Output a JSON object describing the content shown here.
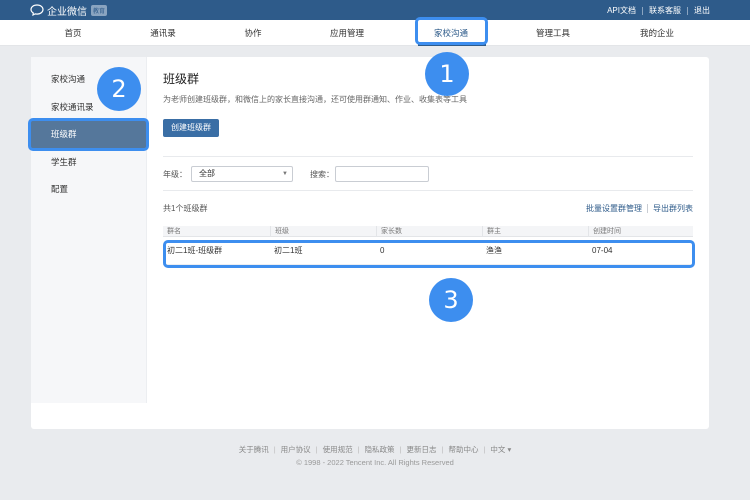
{
  "header": {
    "logo_text": "企业微信",
    "logo_badge": "教育",
    "links": [
      "API文档",
      "联系客服",
      "退出"
    ]
  },
  "nav": {
    "items": [
      "首页",
      "通讯录",
      "协作",
      "应用管理",
      "家校沟通",
      "管理工具",
      "我的企业"
    ],
    "active": "家校沟通"
  },
  "sidebar": {
    "items": [
      "家校沟通",
      "家校通讯录",
      "班级群",
      "学生群",
      "配置"
    ],
    "active": "班级群"
  },
  "main": {
    "title": "班级群",
    "description": "为老师创建班级群，和微信上的家长直接沟通，还可使用群通知、作业、收集表等工具",
    "create_button": "创建班级群",
    "filter": {
      "grade_label": "年级：",
      "grade_value": "全部",
      "search_label": "搜索："
    },
    "count_text": "共1个班级群",
    "actions": [
      "批量设置群管理",
      "导出群列表"
    ],
    "table": {
      "headers": [
        "群名",
        "班级",
        "家长数",
        "群主",
        "创建时间"
      ],
      "rows": [
        [
          "初二1班-班级群",
          "初二1班",
          "0",
          "渔渔",
          "07-04"
        ]
      ]
    }
  },
  "footer": {
    "links": [
      "关于腾讯",
      "用户协议",
      "使用规范",
      "隐私政策",
      "更新日志",
      "帮助中心",
      "中文 ▾"
    ],
    "copyright": "© 1998 - 2022 Tencent Inc. All Rights Reserved"
  },
  "annotations": {
    "badges": [
      "1",
      "2",
      "3"
    ],
    "color": "#3d8eef"
  },
  "colors": {
    "brand": "#2e5b8a",
    "sidebar_active": "#55779b",
    "button": "#3a6ea5"
  }
}
